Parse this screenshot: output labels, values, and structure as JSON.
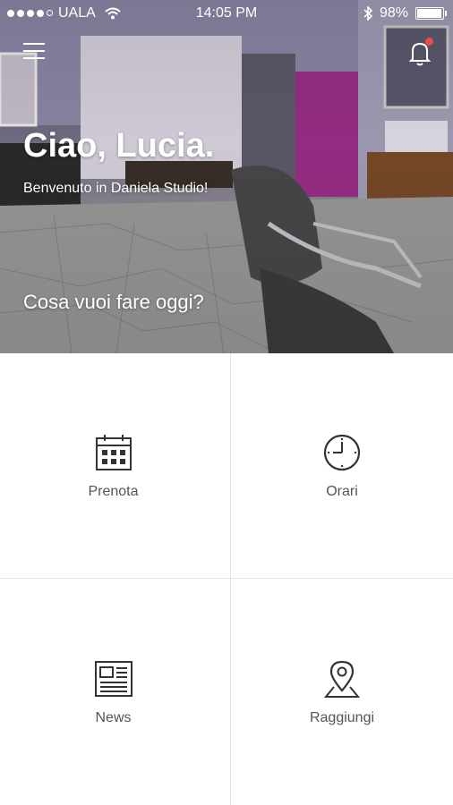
{
  "status_bar": {
    "carrier": "UALA",
    "time": "14:05 PM",
    "battery": "98%"
  },
  "header": {
    "greeting": "Ciao, Lucia.",
    "welcome": "Benvenuto in Daniela Studio!",
    "question": "Cosa vuoi fare oggi?",
    "notification_indicator_color": "#f04a4a"
  },
  "tiles": [
    {
      "label": "Prenota",
      "icon": "calendar-icon"
    },
    {
      "label": "Orari",
      "icon": "clock-icon"
    },
    {
      "label": "News",
      "icon": "newspaper-icon"
    },
    {
      "label": "Raggiungi",
      "icon": "map-pin-icon"
    }
  ]
}
